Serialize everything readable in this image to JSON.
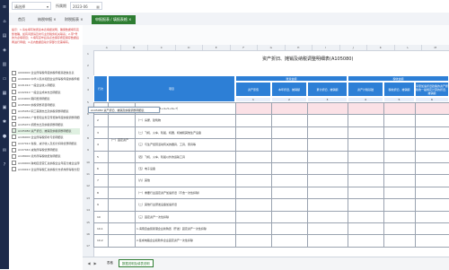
{
  "topbar": {
    "company_field": "请选择",
    "period_label": "所属期",
    "period_value": "2023-06"
  },
  "tabs": [
    {
      "label": "首页",
      "close": ""
    },
    {
      "label": "纳税申报",
      "close": "×"
    },
    {
      "label": "财税报表",
      "close": "×"
    },
    {
      "label": "申报报表 / 填报表格",
      "close": "×"
    }
  ],
  "left_panel": {
    "notice": "提示：1.请在填写前阅读本表填报说明，确保数据填写完整准确，如有问题请及时与主管税务机关联系；2.带*号的为必填项目；3.填写完毕后请点击保存按钮保存数据后再进行申报；4.表内数据自动计算部分无需填写。",
    "items": [
      {
        "label": "A000000 企业所得税年度纳税申报基础信息表",
        "selected": false
      },
      {
        "label": "A100000 中华人民共和国企业所得税年度纳税申报表",
        "selected": false
      },
      {
        "label": "A101010 一般企业收入明细表",
        "selected": false
      },
      {
        "label": "A102010 一般企业成本支出明细表",
        "selected": false
      },
      {
        "label": "A104000 期间费用明细表",
        "selected": false
      },
      {
        "label": "A105000 纳税调整项目明细表",
        "selected": false
      },
      {
        "label": "A105050 职工薪酬支出及纳税调整明细表",
        "selected": false
      },
      {
        "label": "A105060 广告费和业务宣传费跨年度纳税调整明细表",
        "selected": false
      },
      {
        "label": "A105070 捐赠支出及纳税调整明细表",
        "selected": false
      },
      {
        "label": "A105080 资产折旧、摊销及纳税调整明细表",
        "selected": true
      },
      {
        "label": "A106000 企业所得税弥补亏损明细表",
        "selected": false
      },
      {
        "label": "A107010 免税、减计收入及加计扣除优惠明细表",
        "selected": false
      },
      {
        "label": "A107040 减免所得税优惠明细表",
        "selected": false
      },
      {
        "label": "A108000 境外所得税收抵免明细表",
        "selected": false
      },
      {
        "label": "A109000 跨地区经营汇总纳税企业年度分摊企业所得税明细表",
        "selected": false
      },
      {
        "label": "A109010 企业所得税汇总纳税分支机构所得税分配表",
        "selected": false
      }
    ]
  },
  "sheet": {
    "title": "资产折旧、摊销及纳税调整明细表(A105080)",
    "columns": [
      "A",
      "B",
      "C",
      "D",
      "E",
      "F",
      "G",
      "H",
      "I",
      "J",
      "K",
      "L",
      "M"
    ],
    "header": {
      "row_no": "行次",
      "item": "项目",
      "group1": "账载金额",
      "group2": "税收金额",
      "h_c1": "资产原值",
      "h_c2": "本年折旧、摊销额",
      "h_c3": "累计折旧、摊销额",
      "h_c4": "资产计税基础",
      "h_c5": "税收折旧、摊销额",
      "h_c6": "享受加速折旧政策的资产按税收一般规定计算的折旧、摊销额",
      "num1": "1",
      "num2": "2",
      "num3": "3",
      "num4": "4",
      "num5": "5",
      "num6": "6"
    },
    "category_label": "（一）固定资产",
    "rows": [
      {
        "no": "1",
        "item": "一、固定资产（2+3+4+5+6+7）"
      },
      {
        "no": "2",
        "item": "（一）房屋、建筑物"
      },
      {
        "no": "3",
        "item": "（二）飞机、火车、轮船、机器、机械和其他生产设备"
      },
      {
        "no": "4",
        "item": "（三）与生产经营活动有关的器具、工具、家具等"
      },
      {
        "no": "5",
        "item": "（四）飞机、火车、轮船以外的运输工具"
      },
      {
        "no": "6",
        "item": "（五）电子设备"
      },
      {
        "no": "7",
        "item": "（六）其他"
      },
      {
        "no": "8",
        "item": "（一）重要行业固定资产加速折旧（不含一次性扣除）"
      },
      {
        "no": "9",
        "item": "（二）其他行业研发设备加速折旧"
      },
      {
        "no": "10",
        "item": "（三）固定资产一次性扣除"
      },
      {
        "no": "10.1",
        "item": "1.海南自由贸易港企业新购置（开发）固定资产一次性扣除"
      },
      {
        "no": "10.2",
        "item": "2.集成电路企业和软件企业固定资产一次性扣除"
      }
    ],
    "tooltip": "A105080 资产折旧、摊销及纳税调整明细表"
  },
  "bottom_tabs": {
    "arrows": [
      "◀",
      "▶"
    ],
    "tabs": [
      "表格",
      "数据说明及填表说明"
    ]
  }
}
